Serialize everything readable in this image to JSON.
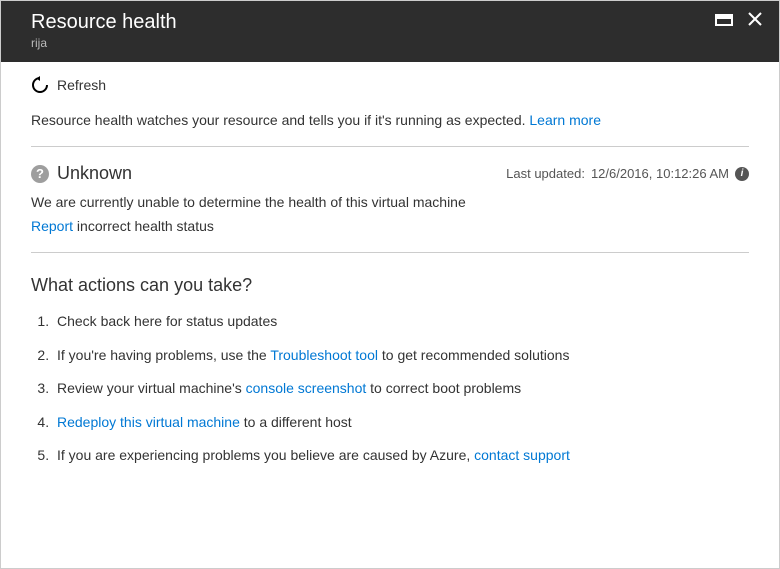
{
  "header": {
    "title": "Resource health",
    "subtitle": "rija"
  },
  "toolbar": {
    "refresh_label": "Refresh"
  },
  "intro": {
    "text": "Resource health watches your resource and tells you if it's running as expected. ",
    "link": "Learn more"
  },
  "status": {
    "title": "Unknown",
    "last_updated_label": "Last updated: ",
    "last_updated_value": "12/6/2016, 10:12:26 AM",
    "description": "We are currently unable to determine the health of this virtual machine",
    "report_link": "Report",
    "report_rest": " incorrect health status"
  },
  "actions": {
    "title": "What actions can you take?",
    "items": [
      {
        "pre": "Check back here for status updates",
        "link": "",
        "post": ""
      },
      {
        "pre": "If you're having problems, use the ",
        "link": "Troubleshoot tool",
        "post": " to get recommended solutions"
      },
      {
        "pre": "Review your virtual machine's ",
        "link": "console screenshot",
        "post": " to correct boot problems"
      },
      {
        "pre": "",
        "link": "Redeploy this virtual machine",
        "post": " to a different host"
      },
      {
        "pre": "If you are experiencing problems you believe are caused by Azure, ",
        "link": "contact support",
        "post": ""
      }
    ]
  }
}
